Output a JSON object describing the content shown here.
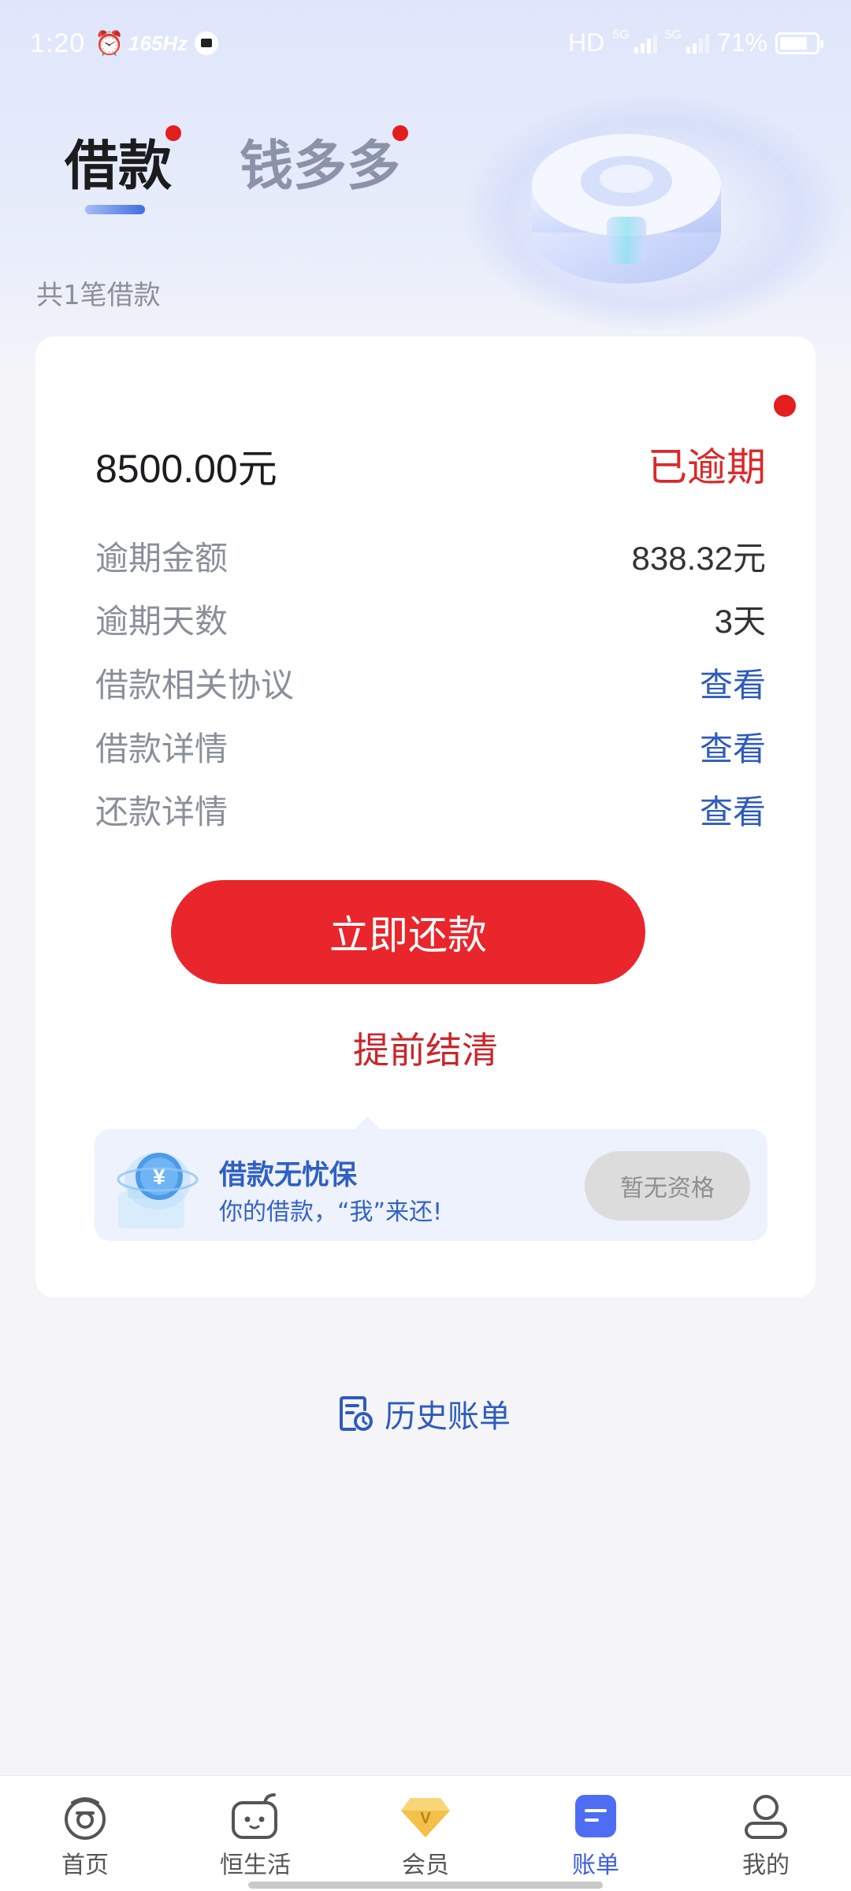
{
  "status_bar": {
    "time": "1:20",
    "refresh_rate": "165Hz",
    "network_hd": "HD",
    "network_5g_1": "5G",
    "network_5g_2": "5G",
    "battery": "71%"
  },
  "tabs": [
    {
      "label": "借款",
      "active": true,
      "has_badge": true
    },
    {
      "label": "钱多多",
      "active": false,
      "has_badge": true
    }
  ],
  "loan_count": "共1笔借款",
  "loan_card": {
    "amount": "8500.00元",
    "status": "已逾期",
    "rows": [
      {
        "label": "逾期金额",
        "value": "838.32元"
      },
      {
        "label": "逾期天数",
        "value": "3天"
      },
      {
        "label": "借款相关协议",
        "value": "查看"
      },
      {
        "label": "借款详情",
        "value": "查看"
      },
      {
        "label": "还款详情",
        "value": "查看"
      }
    ],
    "pay_button": "立即还款",
    "prepay_link": "提前结清"
  },
  "insurance": {
    "title": "借款无忧保",
    "subtitle": "你的借款，“我”来还!",
    "button": "暂无资格"
  },
  "history_link": "历史账单",
  "bottom_nav": [
    {
      "label": "首页",
      "icon": "home-icon",
      "active": false
    },
    {
      "label": "恒生活",
      "icon": "life-icon",
      "active": false
    },
    {
      "label": "会员",
      "icon": "vip-diamond-icon",
      "active": false
    },
    {
      "label": "账单",
      "icon": "bill-icon",
      "active": true
    },
    {
      "label": "我的",
      "icon": "profile-icon",
      "active": false
    }
  ],
  "colors": {
    "accent_red": "#e8262b",
    "link_blue": "#2e5bbd",
    "active_nav": "#3b5fe2"
  }
}
